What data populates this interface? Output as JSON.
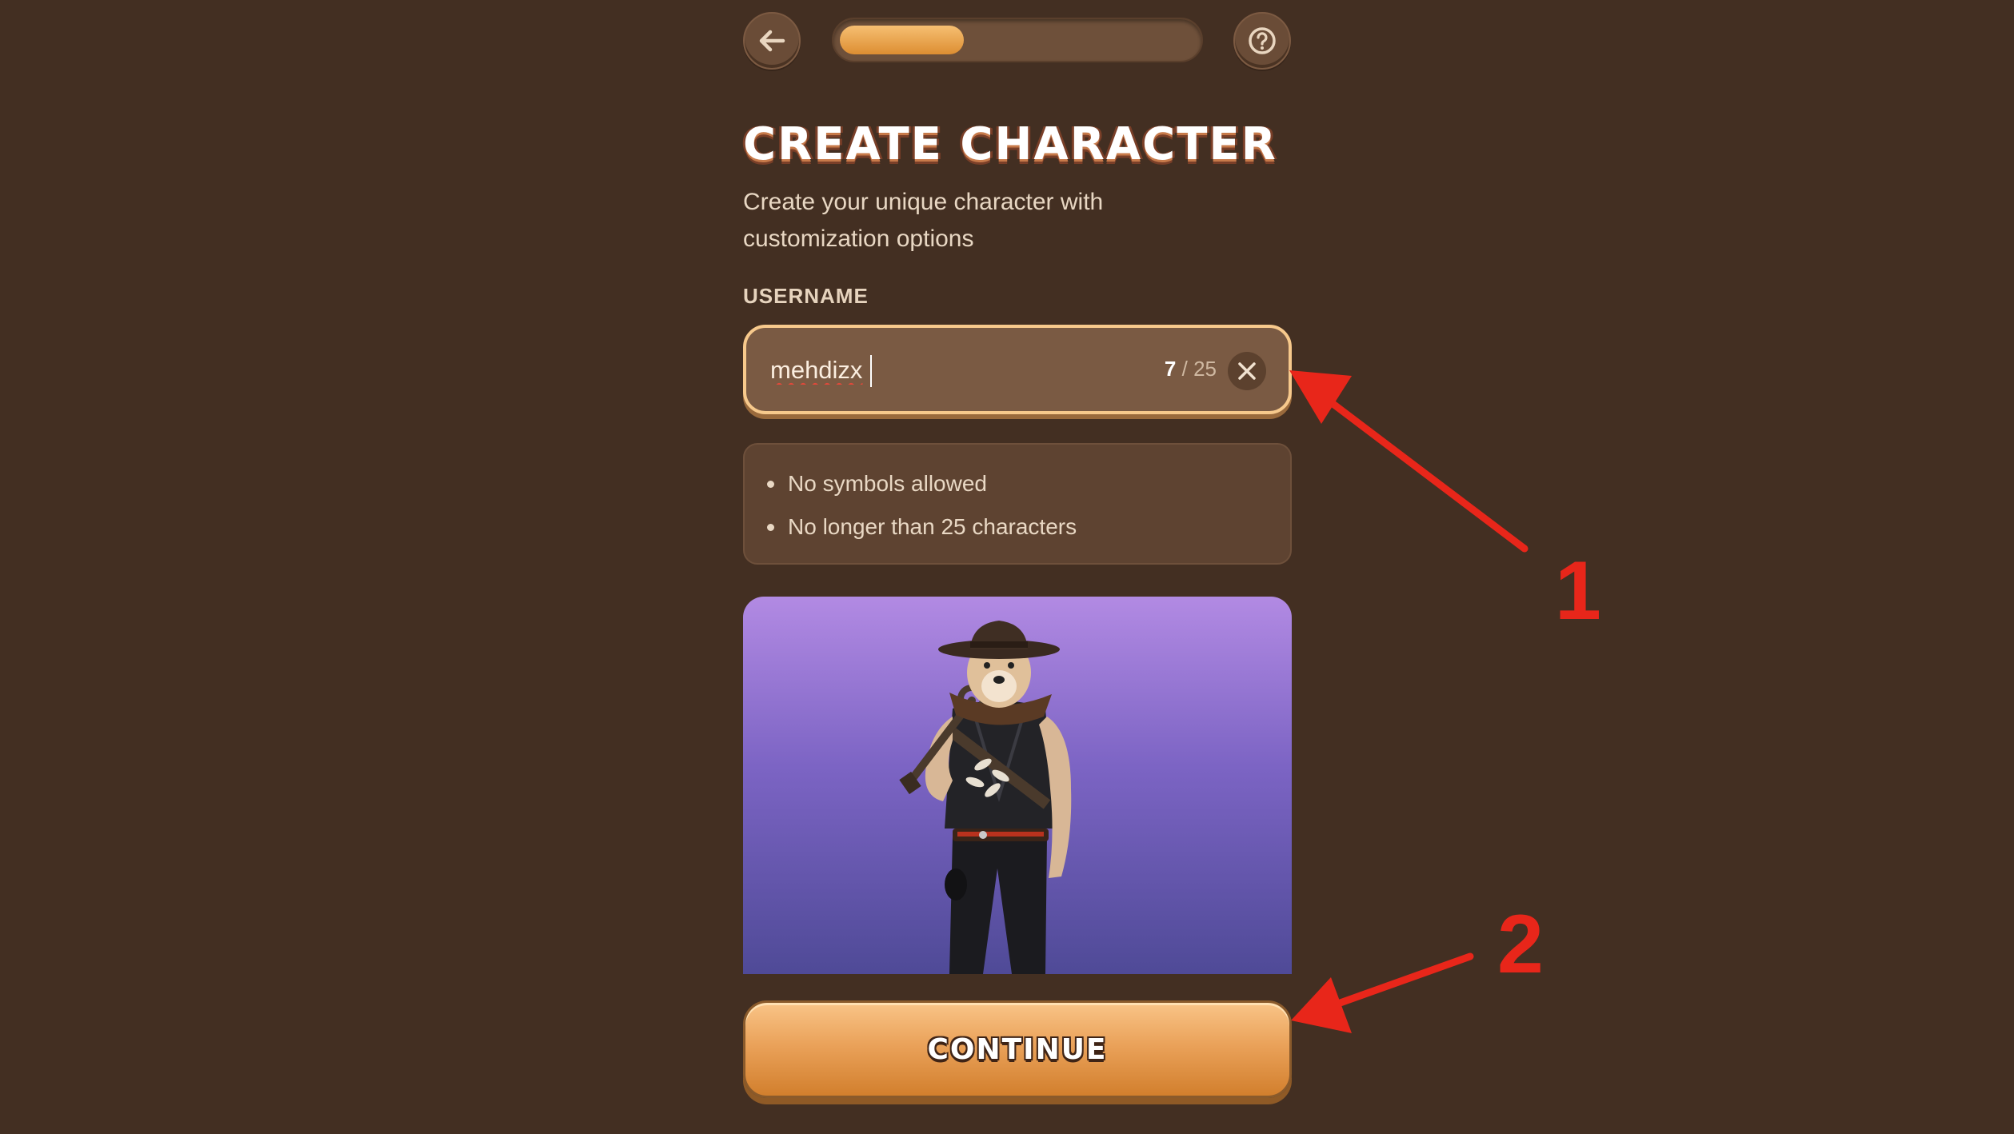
{
  "header": {
    "back_icon": "arrow-left-icon",
    "help_icon": "question-circle-icon",
    "progress_fraction": 0.35
  },
  "title": "CREATE CHARACTER",
  "subtitle": "Create your unique character with customization options",
  "username": {
    "label": "USERNAME",
    "value": "mehdizx",
    "count_current": "7",
    "count_separator": "/",
    "count_max": "25",
    "clear_icon": "close-icon"
  },
  "rules": [
    "No symbols allowed",
    "No longer than 25 characters"
  ],
  "character_image": "shiba-cowboy-character",
  "continue_label": "CONTINUE",
  "annotations": {
    "label_1": "1",
    "label_2": "2"
  },
  "colors": {
    "background": "#432f22",
    "accent": "#e8a04c",
    "annotation": "#e8261a"
  }
}
